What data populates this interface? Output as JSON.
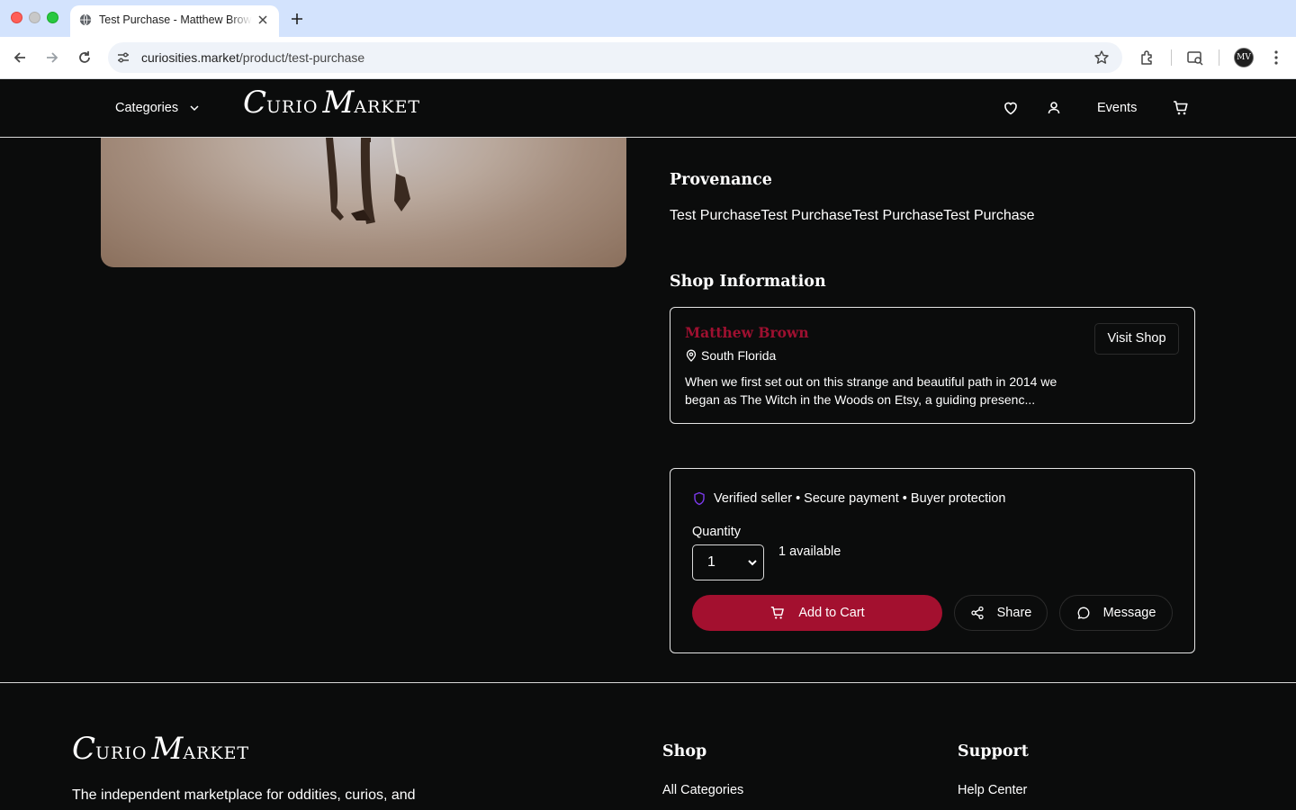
{
  "browser": {
    "tab_title": "Test Purchase - Matthew Brown",
    "url_host": "curiosities.market",
    "url_path": "/product/test-purchase",
    "profile_initials": "MV"
  },
  "header": {
    "categories_label": "Categories",
    "logo": {
      "c": "C",
      "urio": "URIO",
      "m": "M",
      "arket": "ARKET"
    },
    "events_label": "Events"
  },
  "provenance": {
    "title": "Provenance",
    "text": "Test PurchaseTest PurchaseTest PurchaseTest Purchase"
  },
  "shop": {
    "title": "Shop Information",
    "name": "Matthew Brown",
    "location": "South Florida",
    "description": "When we first set out on this strange and beautiful path in 2014 we began as The Witch in the Woods on Etsy, a guiding presenc...",
    "visit_label": "Visit Shop"
  },
  "purchase": {
    "trust_text": "Verified seller • Secure payment • Buyer protection",
    "quantity_label": "Quantity",
    "quantity_value": "1",
    "available_text": "1 available",
    "add_to_cart_label": "Add to Cart",
    "share_label": "Share",
    "message_label": "Message"
  },
  "footer": {
    "tagline": "The independent marketplace for oddities, curios, and",
    "shop_heading": "Shop",
    "shop_link_1": "All Categories",
    "support_heading": "Support",
    "support_link_1": "Help Center"
  },
  "colors": {
    "accent": "#a3102f",
    "shop_name": "#9e1030",
    "background": "#0b0c0c",
    "shield": "#7c3aed"
  }
}
